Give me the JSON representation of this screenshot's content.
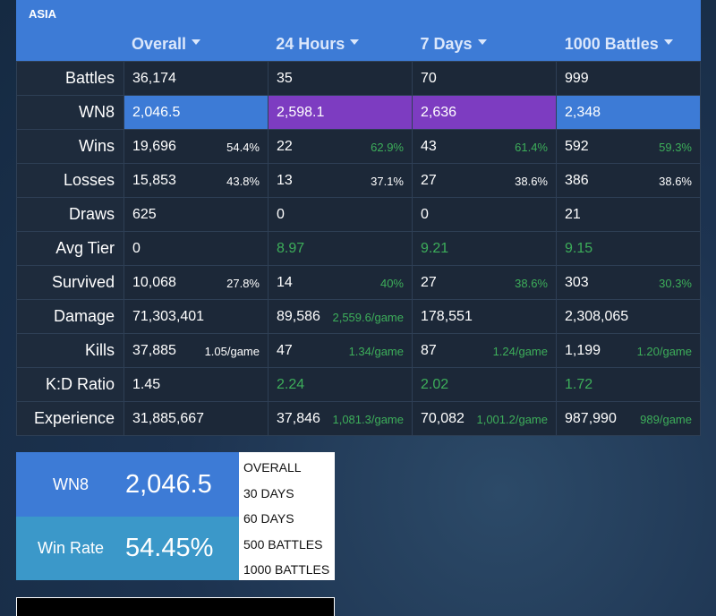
{
  "region": "ASIA",
  "columns": [
    {
      "label": "Overall"
    },
    {
      "label": "24 Hours"
    },
    {
      "label": "7 Days"
    },
    {
      "label": "1000 Battles"
    }
  ],
  "rows": [
    {
      "label": "Battles",
      "cells": [
        {
          "v": "36,174",
          "s": ""
        },
        {
          "v": "35",
          "s": ""
        },
        {
          "v": "70",
          "s": ""
        },
        {
          "v": "999",
          "s": ""
        }
      ]
    },
    {
      "label": "WN8",
      "cells": [
        {
          "v": "2,046.5",
          "s": "",
          "bg": "blue"
        },
        {
          "v": "2,598.1",
          "s": "",
          "bg": "purple"
        },
        {
          "v": "2,636",
          "s": "",
          "bg": "purple"
        },
        {
          "v": "2,348",
          "s": "",
          "bg": "blue"
        }
      ]
    },
    {
      "label": "Wins",
      "cells": [
        {
          "v": "19,696",
          "s": "54.4%"
        },
        {
          "v": "22",
          "s": "62.9%",
          "sg": true
        },
        {
          "v": "43",
          "s": "61.4%",
          "sg": true
        },
        {
          "v": "592",
          "s": "59.3%",
          "sg": true
        }
      ]
    },
    {
      "label": "Losses",
      "cells": [
        {
          "v": "15,853",
          "s": "43.8%"
        },
        {
          "v": "13",
          "s": "37.1%"
        },
        {
          "v": "27",
          "s": "38.6%"
        },
        {
          "v": "386",
          "s": "38.6%"
        }
      ]
    },
    {
      "label": "Draws",
      "cells": [
        {
          "v": "625",
          "s": ""
        },
        {
          "v": "0",
          "s": ""
        },
        {
          "v": "0",
          "s": ""
        },
        {
          "v": "21",
          "s": ""
        }
      ]
    },
    {
      "label": "Avg Tier",
      "cells": [
        {
          "v": "0",
          "s": ""
        },
        {
          "v": "8.97",
          "s": "",
          "vg": true
        },
        {
          "v": "9.21",
          "s": "",
          "vg": true
        },
        {
          "v": "9.15",
          "s": "",
          "vg": true
        }
      ]
    },
    {
      "label": "Survived",
      "cells": [
        {
          "v": "10,068",
          "s": "27.8%"
        },
        {
          "v": "14",
          "s": "40%",
          "sg": true
        },
        {
          "v": "27",
          "s": "38.6%",
          "sg": true
        },
        {
          "v": "303",
          "s": "30.3%",
          "sg": true
        }
      ]
    },
    {
      "label": "Damage",
      "cells": [
        {
          "v": "71,303,401",
          "s": ""
        },
        {
          "v": "89,586",
          "s": "2,559.6/game",
          "sg": true
        },
        {
          "v": "178,551",
          "s": ""
        },
        {
          "v": "2,308,065",
          "s": ""
        }
      ]
    },
    {
      "label": "Kills",
      "cells": [
        {
          "v": "37,885",
          "s": "1.05/game"
        },
        {
          "v": "47",
          "s": "1.34/game",
          "sg": true
        },
        {
          "v": "87",
          "s": "1.24/game",
          "sg": true
        },
        {
          "v": "1,199",
          "s": "1.20/game",
          "sg": true
        }
      ]
    },
    {
      "label": "K:D Ratio",
      "cells": [
        {
          "v": "1.45",
          "s": ""
        },
        {
          "v": "2.24",
          "s": "",
          "vg": true
        },
        {
          "v": "2.02",
          "s": "",
          "vg": true
        },
        {
          "v": "1.72",
          "s": "",
          "vg": true
        }
      ]
    },
    {
      "label": "Experience",
      "cells": [
        {
          "v": "31,885,667",
          "s": ""
        },
        {
          "v": "37,846",
          "s": "1,081.3/game",
          "sg": true
        },
        {
          "v": "70,082",
          "s": "1,001.2/game",
          "sg": true
        },
        {
          "v": "987,990",
          "s": "989/game",
          "sg": true
        }
      ]
    }
  ],
  "summary": {
    "wn8_label": "WN8",
    "wn8_value": "2,046.5",
    "winrate_label": "Win Rate",
    "winrate_value": "54.45%"
  },
  "period_menu": [
    "OVERALL",
    "30 DAYS",
    "60 DAYS",
    "500 BATTLES",
    "1000 BATTLES"
  ],
  "colors": {
    "blue": "#3d7bd6",
    "purple": "#7d3cc1",
    "green": "#3dae5a",
    "cell": "#1c2838"
  }
}
